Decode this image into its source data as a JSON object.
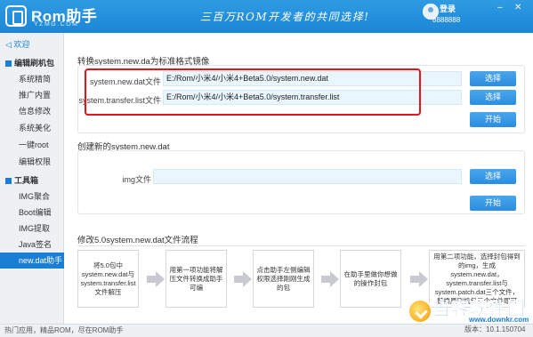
{
  "header": {
    "logo_text": "Rom助手",
    "logo_sub": "YZMG.COM",
    "slogan": "三百万ROM开发者的共同选择!",
    "login": "登录",
    "user_id": "8888888",
    "controls": {
      "min": "–",
      "close": "✕"
    }
  },
  "sidebar": {
    "home": "欢迎",
    "groups": [
      {
        "label": "编辑刷机包",
        "items": [
          "系统精简",
          "推广内置",
          "信息修改",
          "系统美化",
          "一键root",
          "编辑权限"
        ]
      },
      {
        "label": "工具箱",
        "items": [
          "IMG聚合",
          "Boot编辑",
          "IMG提取",
          "Java签名",
          "new.dat助手"
        ]
      }
    ],
    "active": "new.dat助手"
  },
  "section1": {
    "title": "转换system.new.da为标准格式镜像",
    "rows": [
      {
        "label": "system.new.dat文件",
        "value": "E:/Rom/小米4/小米4+Beta5.0/system.new.dat",
        "button": "选择"
      },
      {
        "label": "system.transfer.list文件",
        "value": "E:/Rom/小米4/小米4+Beta5.0/system.transfer.list",
        "button": "选择"
      }
    ],
    "start": "开始"
  },
  "section2": {
    "title": "创建新的system.new.dat",
    "label": "img文件",
    "value": "",
    "button": "选择",
    "start": "开始"
  },
  "section3": {
    "title": "修改5.0system.new.dat文件流程",
    "steps": [
      "将5.0包中system.new.dat与system.transfer.list文件解压",
      "用第一项功能将解压文件转换成助手可编",
      "点击助手左侧编辑权限选择刚刚生成的包",
      "在助手里做你想做的操作封包",
      "用第二项功能，选择封包得到的img，生成 system.new.dat，system.transfer.list与system.patch.dat三个文件，替换原刷机包三个文件即可"
    ]
  },
  "footer": {
    "text": "热门应用，精品ROM，尽在ROM助手",
    "version": "版本：10.1.150704"
  },
  "watermark": {
    "text": "当客软件园",
    "url": "www.downkr.com"
  },
  "colors": {
    "header": "#1b86d6",
    "accent": "#1a7fd4",
    "highlight": "#e3141b"
  }
}
